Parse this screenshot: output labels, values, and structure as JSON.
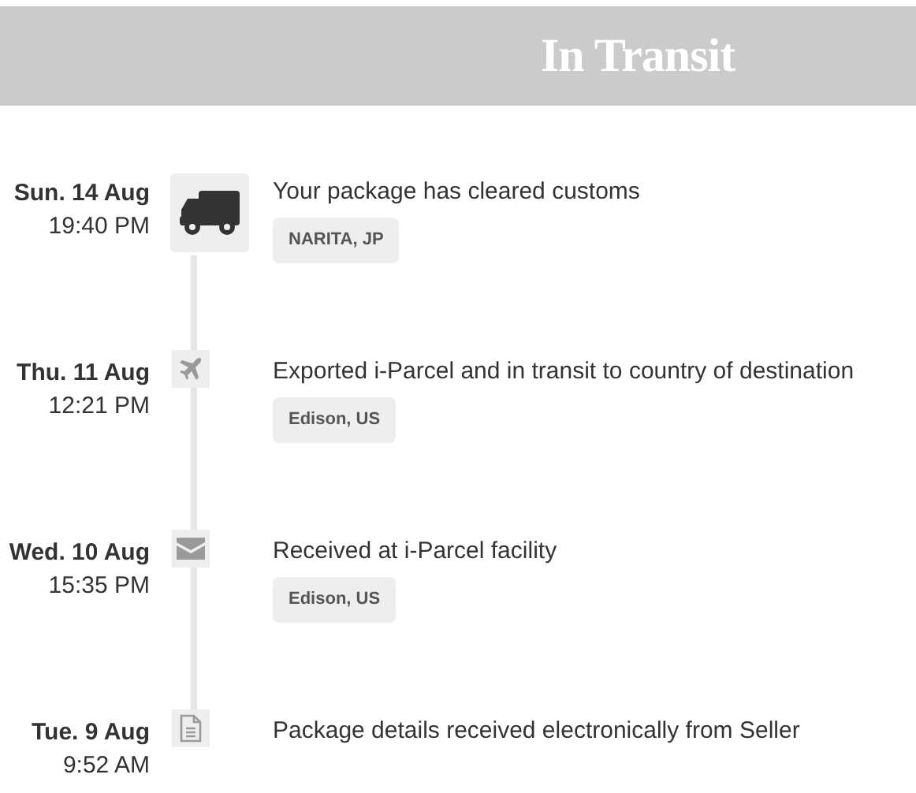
{
  "header": {
    "title": "In Transit"
  },
  "events": [
    {
      "day": "Sun. 14 Aug",
      "time": "19:40 PM",
      "kind": "truck",
      "current": true,
      "description": "Your package has cleared customs",
      "location": "NARITA, JP"
    },
    {
      "day": "Thu. 11 Aug",
      "time": "12:21 PM",
      "kind": "plane",
      "current": false,
      "description": "Exported i-Parcel and in transit to country of destination",
      "location": "Edison, US"
    },
    {
      "day": "Wed. 10 Aug",
      "time": "15:35 PM",
      "kind": "envelope",
      "current": false,
      "description": "Received at i-Parcel facility",
      "location": "Edison, US"
    },
    {
      "day": "Tue. 9 Aug",
      "time": "9:52 AM",
      "kind": "document",
      "current": false,
      "description": "Package details received electronically from Seller"
    }
  ]
}
